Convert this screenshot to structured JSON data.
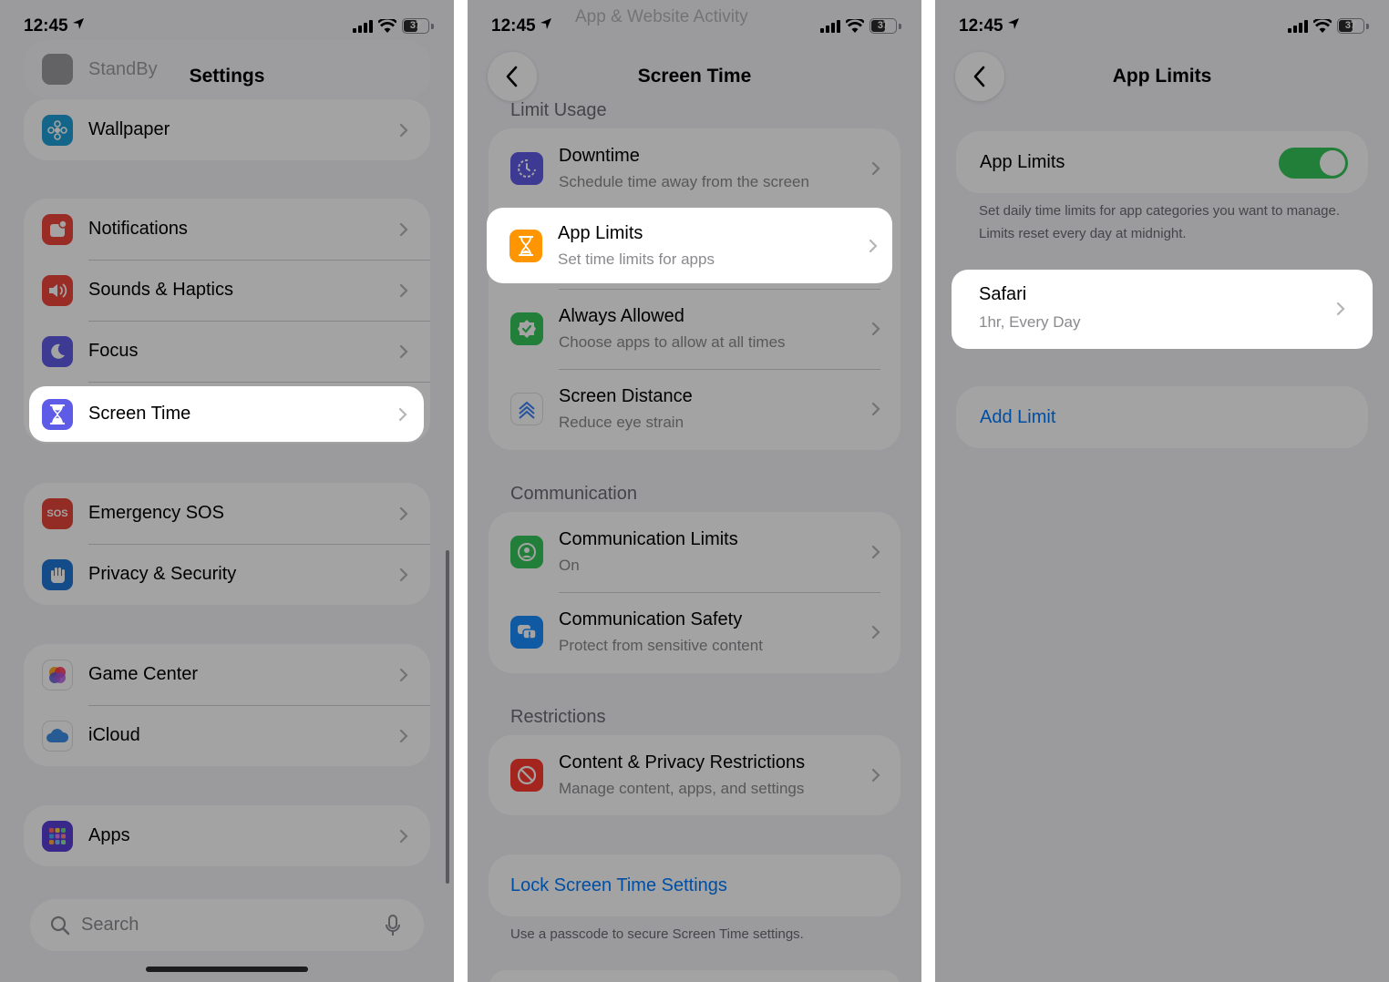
{
  "status": {
    "time": "12:45",
    "battery": "37"
  },
  "panel1": {
    "title": "Settings",
    "ghost_item": "StandBy",
    "groups": [
      {
        "items": [
          {
            "label": "Wallpaper",
            "icon": "wallpaper-icon",
            "color": "#1fa0d6"
          }
        ]
      },
      {
        "items": [
          {
            "label": "Notifications",
            "icon": "notifications-icon",
            "color": "#f0453a"
          },
          {
            "label": "Sounds & Haptics",
            "icon": "speaker-icon",
            "color": "#f0453a"
          },
          {
            "label": "Focus",
            "icon": "moon-icon",
            "color": "#5e5ce6"
          },
          {
            "label": "Screen Time",
            "icon": "hourglass-icon",
            "color": "#5e5ce6"
          }
        ]
      },
      {
        "items": [
          {
            "label": "Emergency SOS",
            "icon": "sos-icon",
            "color": "#e5463b"
          },
          {
            "label": "Privacy & Security",
            "icon": "hand-icon",
            "color": "#1e78d6"
          }
        ]
      },
      {
        "items": [
          {
            "label": "Game Center",
            "icon": "game-center-icon",
            "color": "#ffffff"
          },
          {
            "label": "iCloud",
            "icon": "cloud-icon",
            "color": "#ffffff"
          }
        ]
      },
      {
        "items": [
          {
            "label": "Apps",
            "icon": "apps-grid-icon",
            "color": "#5a3fd6"
          }
        ]
      }
    ],
    "search_placeholder": "Search",
    "sos_text": "SOS"
  },
  "panel2": {
    "title": "Screen Time",
    "ghost_title": "App & Website Activity",
    "section_limit": "Limit Usage",
    "limit_items": [
      {
        "title": "Downtime",
        "subtitle": "Schedule time away from the screen",
        "color": "#5e5ce6"
      },
      {
        "title": "App Limits",
        "subtitle": "Set time limits for apps",
        "color": "#ff9500"
      },
      {
        "title": "Always Allowed",
        "subtitle": "Choose apps to allow at all times",
        "color": "#34c759"
      },
      {
        "title": "Screen Distance",
        "subtitle": "Reduce eye strain",
        "color": "#ffffff"
      }
    ],
    "section_comm": "Communication",
    "comm_items": [
      {
        "title": "Communication Limits",
        "subtitle": "On",
        "color": "#34c759"
      },
      {
        "title": "Communication Safety",
        "subtitle": "Protect from sensitive content",
        "color": "#1a8cff"
      }
    ],
    "section_restr": "Restrictions",
    "restr_items": [
      {
        "title": "Content & Privacy Restrictions",
        "subtitle": "Manage content, apps, and settings",
        "color": "#ff3b30"
      }
    ],
    "lock_link": "Lock Screen Time Settings",
    "lock_footer": "Use a passcode to secure Screen Time settings."
  },
  "panel3": {
    "title": "App Limits",
    "toggle_label": "App Limits",
    "toggle_on": true,
    "description": "Set daily time limits for app categories you want to manage. Limits reset every day at midnight.",
    "limit_item": {
      "title": "Safari",
      "subtitle": "1hr, Every Day"
    },
    "add_link": "Add Limit"
  }
}
